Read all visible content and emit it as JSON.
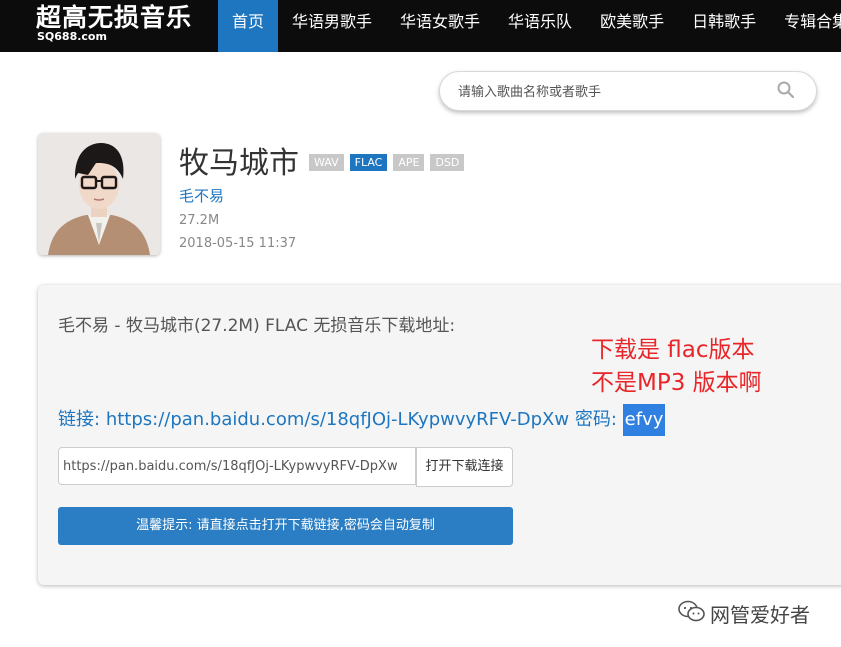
{
  "site": {
    "title": "超高无损音乐",
    "domain": "SQ688.com"
  },
  "nav": [
    "首页",
    "华语男歌手",
    "华语女歌手",
    "华语乐队",
    "欧美歌手",
    "日韩歌手",
    "专辑合集"
  ],
  "search": {
    "placeholder": "请输入歌曲名称或者歌手",
    "icon": "search-icon"
  },
  "album": {
    "title": "牧马城市",
    "formats": [
      "WAV",
      "FLAC",
      "APE",
      "DSD"
    ],
    "active_format": "FLAC",
    "artist": "毛不易",
    "size": "27.2M",
    "date": "2018-05-15 11:37"
  },
  "download": {
    "heading": "毛不易 - 牧马城市(27.2M) FLAC 无损音乐下载地址:",
    "link_label": "链接:",
    "link_url": "https://pan.baidu.com/s/18qfJOj-LKypwvyRFV-DpXw",
    "password_label": "密码:",
    "password": "efvy",
    "input_value": "https://pan.baidu.com/s/18qfJOj-LKypwvyRFV-DpXw",
    "open_button": "打开下载连接",
    "tip": "温馨提示: 请直接点击打开下载链接,密码会自动复制"
  },
  "annotation": {
    "line1": "下载是 flac版本",
    "line2": "不是MP3 版本啊",
    "color": "#e8262a"
  },
  "watermark": {
    "text": "网管爱好者",
    "icon": "wechat-icon"
  },
  "colors": {
    "accent": "#1e76c0",
    "nav_bg": "#0c0c0c",
    "badge_inactive": "#c8c8c8"
  }
}
